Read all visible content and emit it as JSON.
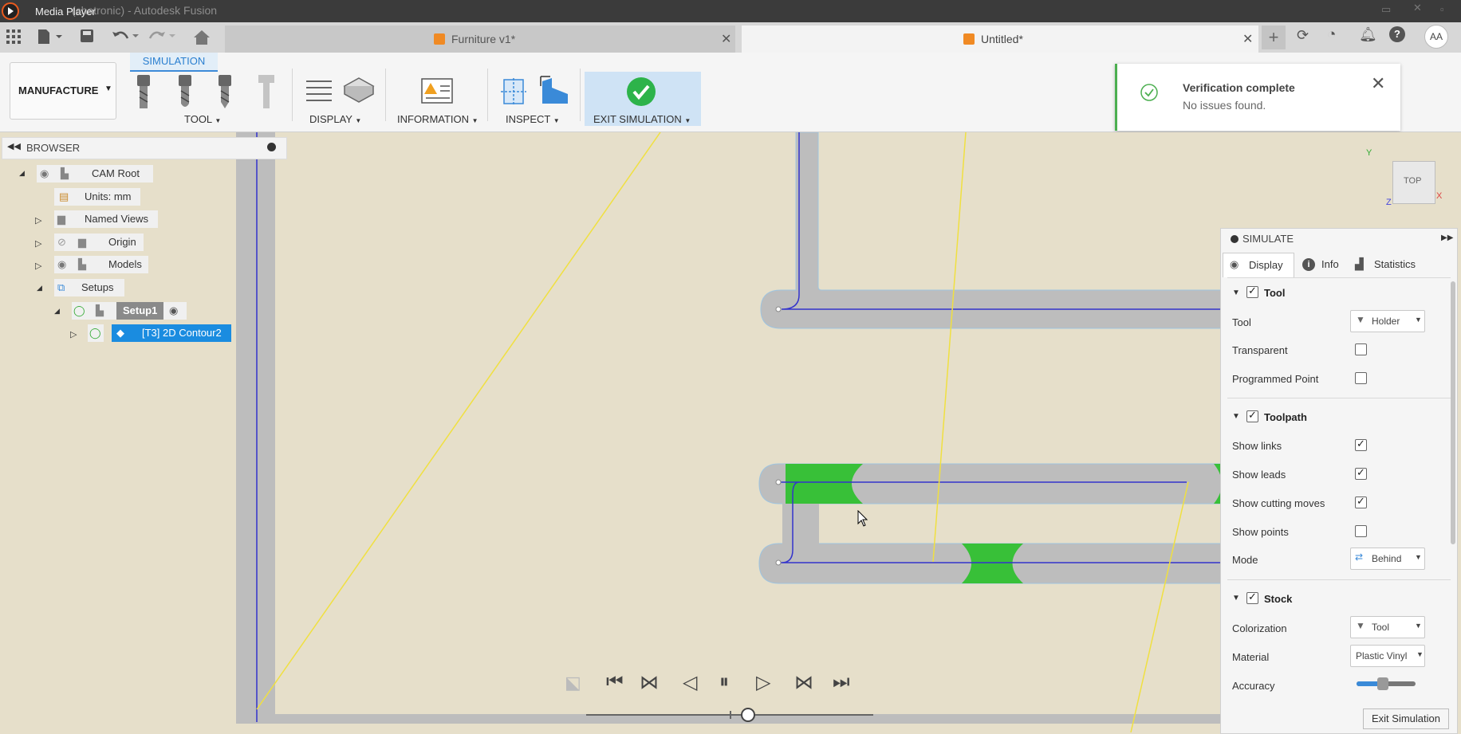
{
  "titlebar": {
    "app_title": "Media Player",
    "window_title": "(chatronic) - Autodesk Fusion"
  },
  "tabs": [
    {
      "label": "Furniture v1*",
      "active": false
    },
    {
      "label": "Untitled*",
      "active": true
    }
  ],
  "ribbon": {
    "workspace": "MANUFACTURE",
    "active_tab": "SIMULATION",
    "groups": {
      "tool": "TOOL",
      "display": "DISPLAY",
      "information": "INFORMATION",
      "inspect": "INSPECT",
      "exit": "EXIT SIMULATION"
    }
  },
  "notification": {
    "title": "Verification complete",
    "message": "No issues found."
  },
  "browser": {
    "title": "BROWSER",
    "items": [
      {
        "label": "CAM Root"
      },
      {
        "label": "Units: mm"
      },
      {
        "label": "Named Views"
      },
      {
        "label": "Origin"
      },
      {
        "label": "Models"
      },
      {
        "label": "Setups"
      },
      {
        "label": "Setup1"
      },
      {
        "label": "[T3] 2D Contour2"
      }
    ]
  },
  "viewcube": {
    "face": "TOP",
    "axes": {
      "x": "X",
      "y": "Y",
      "z": "Z"
    }
  },
  "simulate": {
    "title": "SIMULATE",
    "tabs": [
      "Display",
      "Info",
      "Statistics"
    ],
    "tool_section": {
      "title": "Tool",
      "tool_label": "Tool",
      "tool_value": "Holder",
      "transparent": "Transparent",
      "programmed_point": "Programmed Point"
    },
    "toolpath_section": {
      "title": "Toolpath",
      "show_links": "Show links",
      "show_leads": "Show leads",
      "show_cutting_moves": "Show cutting moves",
      "show_points": "Show points",
      "mode_label": "Mode",
      "mode_value": "Behind"
    },
    "stock_section": {
      "title": "Stock",
      "colorization_label": "Colorization",
      "colorization_value": "Tool",
      "material_label": "Material",
      "material_value": "Plastic Vinyl",
      "accuracy_label": "Accuracy"
    },
    "accuracy_level": 0.45,
    "exit_button": "Exit Simulation"
  },
  "playback": {
    "position": 0.56
  },
  "colors": {
    "viewport": "#e6dfca",
    "stock_gray": "#b9b9b9",
    "cut_green": "#38c038",
    "path_blue": "#3333cc",
    "accent_blue": "#3d8bd8",
    "select_blue": "#1a8ce0"
  }
}
